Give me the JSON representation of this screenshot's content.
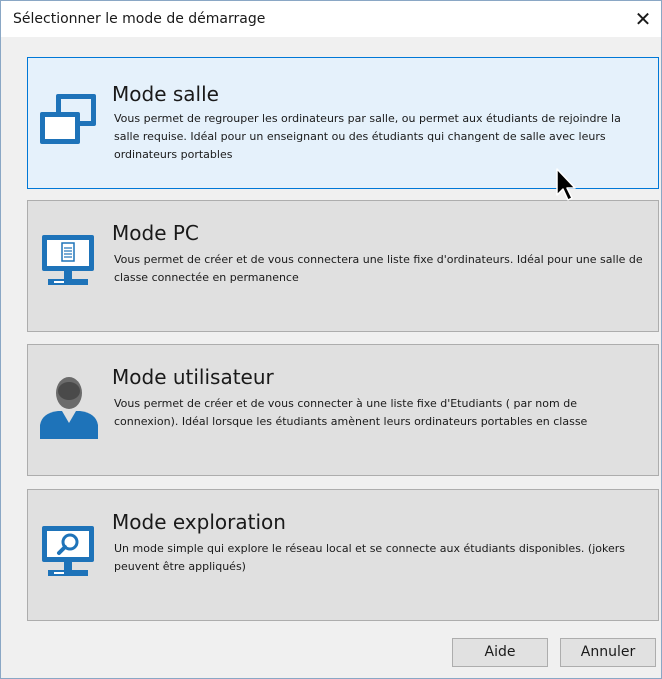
{
  "window": {
    "title": "Sélectionner le mode de démarrage",
    "close_glyph": "✕"
  },
  "modes": [
    {
      "title": "Mode salle",
      "description": "Vous permet de regrouper les ordinateurs par salle, ou permet aux étudiants de rejoindre la salle requise. Idéal pour un enseignant ou des étudiants qui changent de salle avec leurs ordinateurs portables",
      "icon": "rooms-icon",
      "selected": true
    },
    {
      "title": "Mode PC",
      "description": "Vous permet de créer et de vous connectera une liste fixe d'ordinateurs. Idéal pour une salle de classe connectée en permanence",
      "icon": "computer-icon",
      "selected": false
    },
    {
      "title": "Mode utilisateur",
      "description": "Vous permet de créer et de vous connecter à une liste fixe d'Etudiants ( par nom de connexion). Idéal lorsque les étudiants amènent leurs ordinateurs portables en classe",
      "icon": "user-icon",
      "selected": false
    },
    {
      "title": "Mode exploration",
      "description": "Un mode simple qui explore le réseau local et se connecte aux étudiants disponibles. (jokers peuvent être appliqués)",
      "icon": "search-monitor-icon",
      "selected": false
    }
  ],
  "buttons": {
    "help_label": "Aide",
    "cancel_label": "Annuler"
  },
  "colors": {
    "icon_blue": "#1e73b9",
    "selected_border": "#0078d7",
    "selected_background": "#e5f1fb",
    "card_background": "#e0e0e0"
  }
}
